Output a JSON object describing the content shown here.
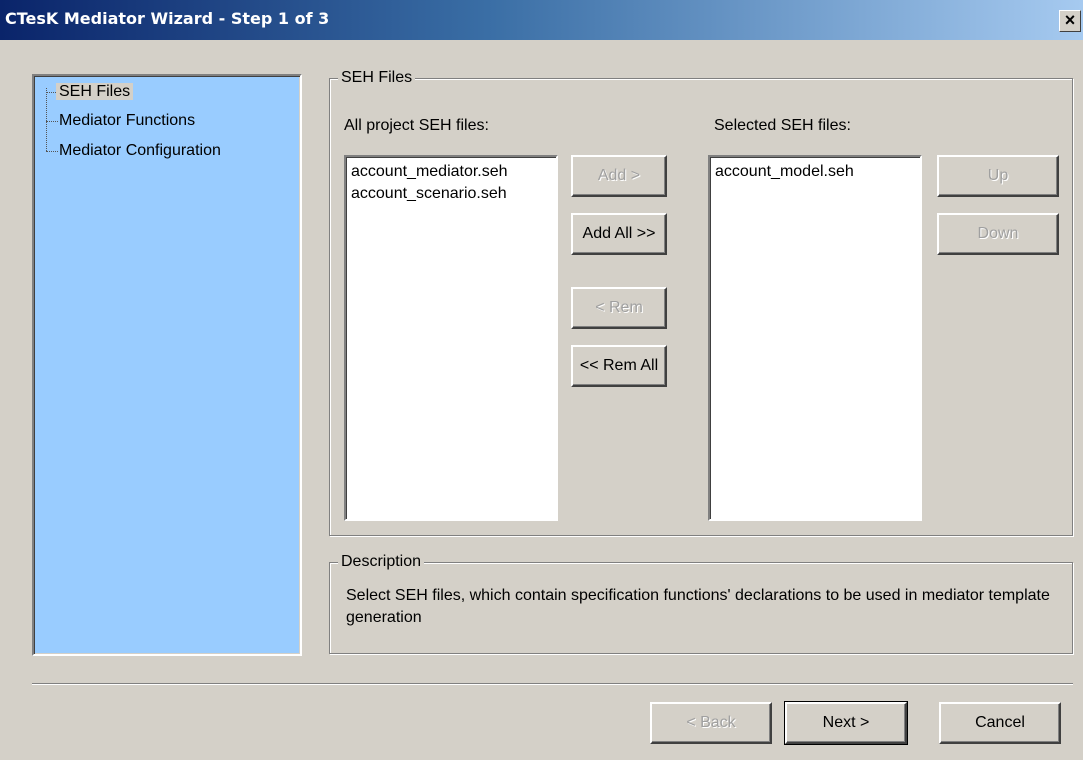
{
  "window": {
    "title": "CTesK Mediator Wizard - Step 1 of 3",
    "close_label": "×"
  },
  "tree": {
    "items": [
      {
        "label": "SEH Files",
        "selected": true
      },
      {
        "label": "Mediator Functions",
        "selected": false
      },
      {
        "label": "Mediator Configuration",
        "selected": false
      }
    ]
  },
  "seh_group": {
    "title": "SEH Files",
    "all_label": "All project SEH files:",
    "selected_label": "Selected SEH files:",
    "all_files": [
      "account_mediator.seh",
      "account_scenario.seh"
    ],
    "selected_files": [
      "account_model.seh"
    ],
    "buttons": {
      "add": "Add >",
      "add_all": "Add All >>",
      "rem": "< Rem",
      "rem_all": "<< Rem All",
      "up": "Up",
      "down": "Down"
    }
  },
  "description": {
    "title": "Description",
    "text": "Select SEH files, which contain specification functions' declarations to be used in mediator template generation"
  },
  "footer": {
    "back": "< Back",
    "next": "Next >",
    "cancel": "Cancel"
  },
  "colors": {
    "tree_bg": "#99ccff",
    "dialog_bg": "#d4d0c8",
    "title_start": "#0a246a"
  }
}
